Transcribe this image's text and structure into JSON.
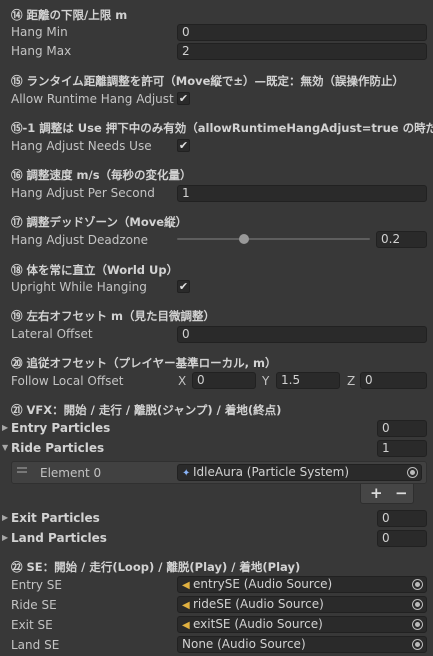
{
  "s14": {
    "header": "⑭ 距離の下限/上限 m",
    "hang_min_label": "Hang Min",
    "hang_min_value": "0",
    "hang_max_label": "Hang Max",
    "hang_max_value": "2"
  },
  "s15": {
    "header": "⑮ ランタイム距離調整を許可（Move縦で±）—既定：無効（誤操作防止）",
    "label": "Allow Runtime Hang Adjust",
    "checked": "✔"
  },
  "s15b": {
    "header": "⑮-1 調整は Use 押下中のみ有効（allowRuntimeHangAdjust=true の時だけ",
    "label": "Hang Adjust Needs Use",
    "checked": "✔"
  },
  "s16": {
    "header": "⑯ 調整速度 m/s（毎秒の変化量）",
    "label": "Hang Adjust Per Second",
    "value": "1"
  },
  "s17": {
    "header": "⑰ 調整デッドゾーン（Move縦）",
    "label": "Hang Adjust Deadzone",
    "value": "0.2",
    "slider_fraction": 0.2
  },
  "s18": {
    "header": "⑱ 体を常に直立（World Up）",
    "label": "Upright While Hanging",
    "checked": "✔"
  },
  "s19": {
    "header": "⑲ 左右オフセット m（見た目微調整）",
    "label": "Lateral Offset",
    "value": "0"
  },
  "s20": {
    "header": "⑳ 追従オフセット（プレイヤー基準ローカル, m）",
    "label": "Follow Local Offset",
    "x_label": "X",
    "x_value": "0",
    "y_label": "Y",
    "y_value": "1.5",
    "z_label": "Z",
    "z_value": "0"
  },
  "s21": {
    "header": "㉑ VFX：開始 / 走行 / 離脱(ジャンプ) / 着地(終点)",
    "entry_label": "Entry Particles",
    "entry_count": "0",
    "ride_label": "Ride Particles",
    "ride_count": "1",
    "element_label": "Element 0",
    "element_value": "IdleAura (Particle System)",
    "add": "+",
    "remove": "−",
    "exit_label": "Exit Particles",
    "exit_count": "0",
    "land_label": "Land Particles",
    "land_count": "0"
  },
  "s22": {
    "header": "㉒ SE：開始 / 走行(Loop) / 離脱(Play) / 着地(Play)",
    "entry_label": "Entry SE",
    "entry_value": "entrySE (Audio Source)",
    "ride_label": "Ride SE",
    "ride_value": "rideSE (Audio Source)",
    "exit_label": "Exit SE",
    "exit_value": "exitSE (Audio Source)",
    "land_label": "Land SE",
    "land_value": "None (Audio Source)"
  }
}
